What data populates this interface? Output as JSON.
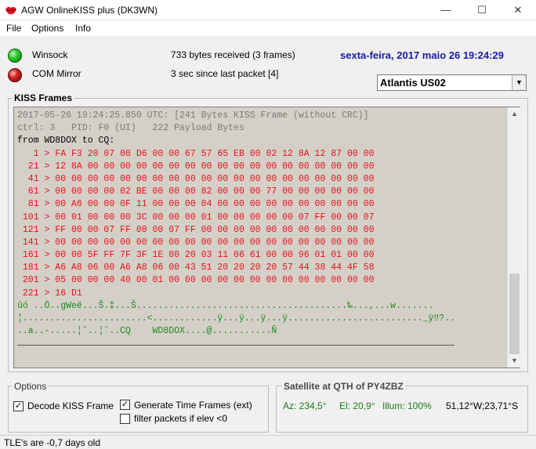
{
  "window": {
    "title": "AGW OnlineKISS plus (DK3WN)",
    "minimize": "—",
    "maximize": "☐",
    "close": "✕",
    "icon": "lips-icon"
  },
  "menu": [
    "File",
    "Options",
    "Info"
  ],
  "status": {
    "winsock_label": "Winsock",
    "com_label": "COM Mirror",
    "bytes_received": "733 bytes received (3 frames)",
    "since_last": "3 sec since last packet [4]",
    "winsock_color": "#2fc62f",
    "com_color": "#d22020"
  },
  "datetime": "sexta-feira, 2017 maio 26  19:24:29",
  "satellite_select": {
    "value": "Atlantis   US02"
  },
  "kiss_frames": {
    "label": "KISS Frames",
    "lines": [
      {
        "cls": "c-gray",
        "text": "2017-05-26 19:24:25.850 UTC: [241 Bytes KISS Frame (without CRC)]"
      },
      {
        "cls": "c-gray",
        "text": "ctrl: 3   PID: F0 (UI)   222 Payload Bytes"
      },
      {
        "cls": "c-black",
        "text": "from WD8DOX to CQ:"
      },
      {
        "cls": "c-red",
        "text": "   1 > FA F3 20 07 00 D6 00 00 67 57 65 EB 00 02 12 8A 12 87 00 00"
      },
      {
        "cls": "c-red",
        "text": "  21 > 12 8A 00 00 00 00 00 00 00 00 00 00 00 00 00 00 00 00 00 00"
      },
      {
        "cls": "c-red",
        "text": "  41 > 00 00 00 00 00 00 00 00 00 00 00 00 00 00 00 00 00 00 00 00"
      },
      {
        "cls": "c-red",
        "text": "  61 > 00 00 00 00 02 BE 00 00 00 82 00 00 00 77 00 00 00 00 00 00"
      },
      {
        "cls": "c-red",
        "text": "  81 > 00 A6 00 00 0F 11 00 00 00 04 00 00 00 00 00 00 00 00 00 00"
      },
      {
        "cls": "c-red",
        "text": " 101 > 00 01 00 00 00 3C 00 00 00 01 00 00 00 00 00 07 FF 00 00 07"
      },
      {
        "cls": "c-red",
        "text": " 121 > FF 00 00 07 FF 00 00 07 FF 00 00 00 00 00 00 00 00 00 00 00"
      },
      {
        "cls": "c-red",
        "text": " 141 > 00 00 00 00 00 00 00 00 00 00 00 00 00 00 00 00 00 00 00 00"
      },
      {
        "cls": "c-red",
        "text": " 161 > 00 00 5F FF 7F 3F 1E 00 20 03 11 06 61 00 00 96 01 01 00 00"
      },
      {
        "cls": "c-red",
        "text": " 181 > A6 A8 06 00 A6 A8 06 00 43 51 20 20 20 20 57 44 38 44 4F 58"
      },
      {
        "cls": "c-red",
        "text": " 201 > 05 00 00 00 40 00 01 00 00 00 00 00 00 00 00 00 00 00 00 00"
      },
      {
        "cls": "c-red",
        "text": " 221 > 16 D1"
      },
      {
        "cls": "c-green",
        "text": "úó ..Ö..gWeë...Š.‡...Š.......................................‰...,...w......."
      },
      {
        "cls": "c-green",
        "text": "¦.......................<............ÿ...ÿ...ÿ...ÿ........................._ÿ‼?.."
      },
      {
        "cls": "c-green",
        "text": "..a..-.....¦ˆ..¦ˆ..CQ    WD8DOX....@...........Ñ"
      }
    ]
  },
  "options": {
    "label": "Options",
    "decode_kiss": {
      "label": "Decode KISS Frame",
      "checked": "✓"
    },
    "gen_time": {
      "label": "Generate Time Frames (ext)",
      "checked": "✓"
    },
    "filter": {
      "label": "filter packets if elev <0",
      "checked": ""
    }
  },
  "satellite_qth": {
    "label": "Satellite at QTH of PY4ZBZ",
    "az": "Az: 234,5°",
    "el": "El: 20,9°",
    "illum": "Illum: 100%",
    "pos": "51,12°W;23,71°S"
  },
  "statusbar": "TLE's are -0,7 days old"
}
